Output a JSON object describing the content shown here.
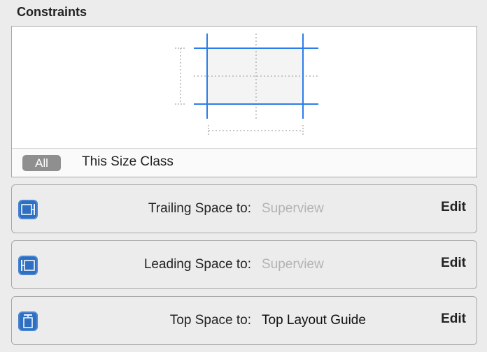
{
  "panel": {
    "title": "Constraints"
  },
  "size_class": {
    "all_label": "All",
    "this_label": "This Size Class"
  },
  "constraints": [
    {
      "label": "Trailing Space to:",
      "value": "Superview",
      "value_state": "placeholder",
      "edit_label": "Edit",
      "icon": "trailing-space-icon"
    },
    {
      "label": "Leading Space to:",
      "value": "Superview",
      "value_state": "placeholder",
      "edit_label": "Edit",
      "icon": "leading-space-icon"
    },
    {
      "label": "Top Space to:",
      "value": "Top Layout Guide",
      "value_state": "set",
      "edit_label": "Edit",
      "icon": "top-space-icon"
    }
  ],
  "colors": {
    "accent": "#2b7de9",
    "icon_blue": "#2f6fc2",
    "muted_text": "#b3b3b3"
  }
}
